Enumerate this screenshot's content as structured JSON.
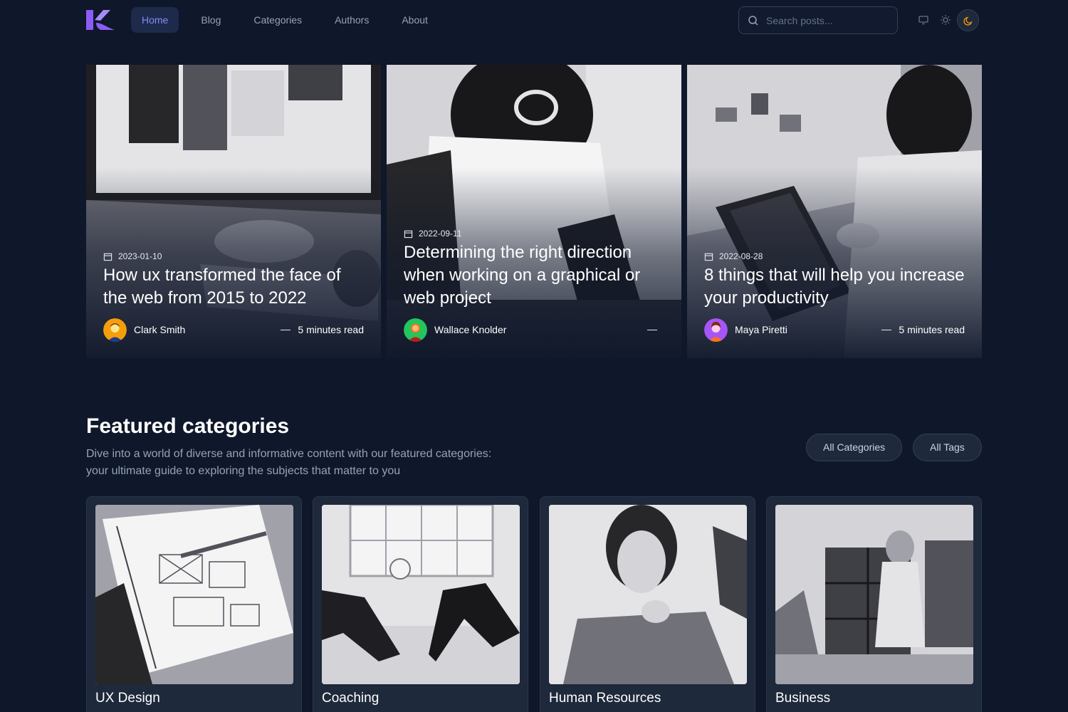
{
  "header": {
    "nav": [
      "Home",
      "Blog",
      "Categories",
      "Authors",
      "About"
    ],
    "active_nav": "Home",
    "search_placeholder": "Search posts...",
    "icons": [
      "monitor-icon",
      "sun-icon",
      "moon-icon"
    ],
    "accent": "#818cf8"
  },
  "hero_posts": [
    {
      "date": "2023-01-10",
      "title": "How ux transformed the face of the web from 2015 to 2022",
      "author": "Clark Smith",
      "read_time": "5 minutes read"
    },
    {
      "date": "2022-09-11",
      "title": "Determining the right direction when working on a graphical or web project",
      "author": "Wallace Knolder",
      "read_time": ""
    },
    {
      "date": "2022-08-28",
      "title": "8 things that will help you increase your productivity",
      "author": "Maya Piretti",
      "read_time": "5 minutes read"
    }
  ],
  "featured": {
    "title": "Featured categories",
    "description": "Dive into a world of diverse and informative content with our featured categories: your ultimate guide to exploring the subjects that matter to you",
    "buttons": [
      "All Categories",
      "All Tags"
    ],
    "categories": [
      {
        "name": "UX Design"
      },
      {
        "name": "Coaching"
      },
      {
        "name": "Human Resources"
      },
      {
        "name": "Business"
      }
    ]
  },
  "colors": {
    "background": "#0f172a",
    "card": "#1e293b",
    "logo": "#8b5cf6"
  }
}
